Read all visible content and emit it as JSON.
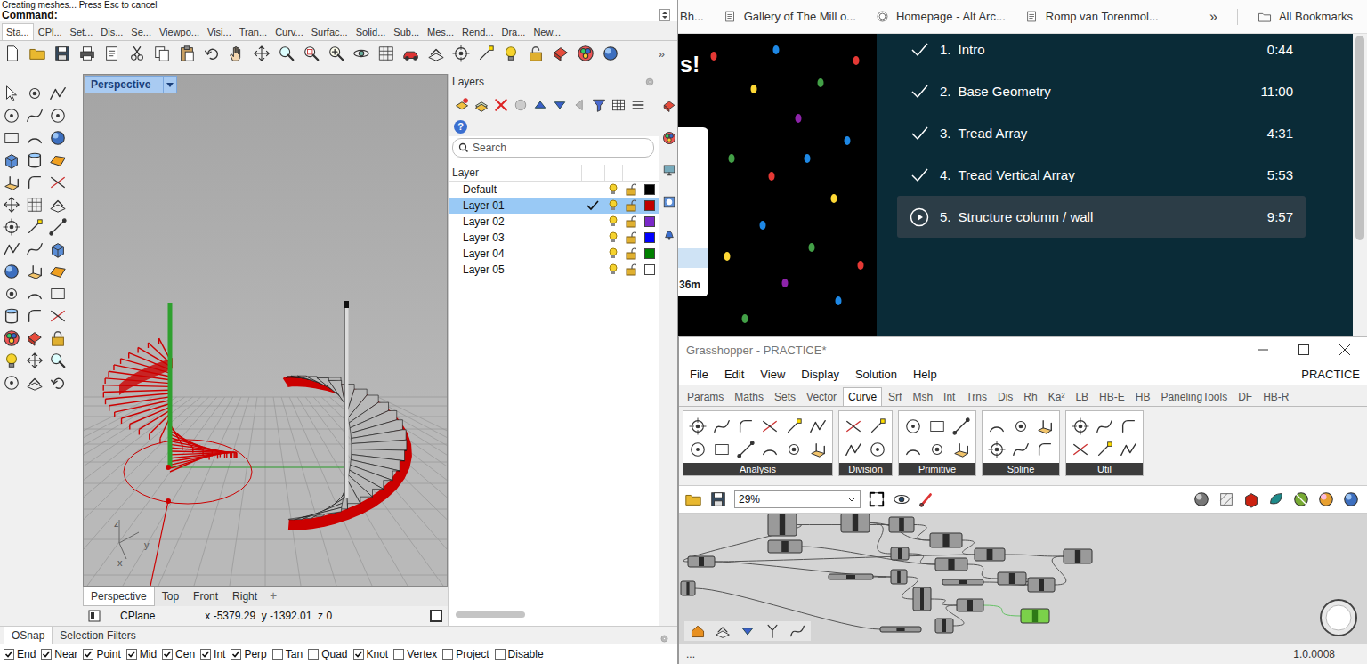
{
  "rhino": {
    "command_history": "Creating meshes... Press Esc to cancel",
    "command_prompt": "Command:",
    "toolbar_tabs": [
      {
        "label": "Sta...",
        "selected": true
      },
      {
        "label": "CPl...",
        "selected": false
      },
      {
        "label": "Set...",
        "selected": false
      },
      {
        "label": "Dis...",
        "selected": false
      },
      {
        "label": "Se...",
        "selected": false
      },
      {
        "label": "Viewpo...",
        "selected": false
      },
      {
        "label": "Visi...",
        "selected": false
      },
      {
        "label": "Tran...",
        "selected": false
      },
      {
        "label": "Curv...",
        "selected": false
      },
      {
        "label": "Surfac...",
        "selected": false
      },
      {
        "label": "Solid...",
        "selected": false
      },
      {
        "label": "Sub...",
        "selected": false
      },
      {
        "label": "Mes...",
        "selected": false
      },
      {
        "label": "Rend...",
        "selected": false
      },
      {
        "label": "Dra...",
        "selected": false
      },
      {
        "label": "New...",
        "selected": false
      }
    ],
    "toolbar_overflow": "»",
    "viewport": {
      "title": "Perspective",
      "axes": [
        "z",
        "y",
        "x"
      ]
    },
    "layers_panel": {
      "title": "Layers",
      "help": "?",
      "search_placeholder": "Search",
      "column": "Layer",
      "layers": [
        {
          "name": "Default",
          "selected": false,
          "current": false,
          "visible": true,
          "locked": false,
          "color": "#000000"
        },
        {
          "name": "Layer 01",
          "selected": true,
          "current": true,
          "visible": true,
          "locked": false,
          "color": "#c00000"
        },
        {
          "name": "Layer 02",
          "selected": false,
          "current": false,
          "visible": true,
          "locked": false,
          "color": "#7a28c8"
        },
        {
          "name": "Layer 03",
          "selected": false,
          "current": false,
          "visible": true,
          "locked": false,
          "color": "#0000ff"
        },
        {
          "name": "Layer 04",
          "selected": false,
          "current": false,
          "visible": true,
          "locked": false,
          "color": "#008000"
        },
        {
          "name": "Layer 05",
          "selected": false,
          "current": false,
          "visible": true,
          "locked": false,
          "color": "#ffffff"
        }
      ]
    },
    "viewport_tabs": [
      {
        "label": "Perspective",
        "selected": true
      },
      {
        "label": "Top",
        "selected": false
      },
      {
        "label": "Front",
        "selected": false
      },
      {
        "label": "Right",
        "selected": false
      }
    ],
    "add_viewport": "+",
    "status": {
      "cplane": "CPlane",
      "coordinates": "x -5379.29  y -1392.01  z 0"
    },
    "panel_tabs": [
      {
        "label": "OSnap",
        "selected": true
      },
      {
        "label": "Selection Filters",
        "selected": false
      }
    ],
    "osnaps": [
      {
        "label": "End",
        "checked": true
      },
      {
        "label": "Near",
        "checked": true
      },
      {
        "label": "Point",
        "checked": true
      },
      {
        "label": "Mid",
        "checked": true
      },
      {
        "label": "Cen",
        "checked": true
      },
      {
        "label": "Int",
        "checked": true
      },
      {
        "label": "Perp",
        "checked": true
      },
      {
        "label": "Tan",
        "checked": false
      },
      {
        "label": "Quad",
        "checked": false
      },
      {
        "label": "Knot",
        "checked": true
      },
      {
        "label": "Vertex",
        "checked": false
      },
      {
        "label": "Project",
        "checked": false
      },
      {
        "label": "Disable",
        "checked": false
      }
    ]
  },
  "browser": {
    "bookmarks": [
      "Bh...",
      "Gallery of The Mill o...",
      "Homepage - Alt Arc...",
      "Romp van Torenmol..."
    ],
    "overflow": "»",
    "all_bookmarks": "All Bookmarks",
    "page": {
      "headline": "s!",
      "card_meta": "36m"
    },
    "lessons": [
      {
        "number": "1.",
        "title": "Intro",
        "duration": "0:44",
        "completed": true,
        "selected": false
      },
      {
        "number": "2.",
        "title": "Base Geometry",
        "duration": "11:00",
        "completed": true,
        "selected": false
      },
      {
        "number": "3.",
        "title": "Tread Array",
        "duration": "4:31",
        "completed": true,
        "selected": false
      },
      {
        "number": "4.",
        "title": "Tread Vertical Array",
        "duration": "5:53",
        "completed": true,
        "selected": false
      },
      {
        "number": "5.",
        "title": "Structure column / wall",
        "duration": "9:57",
        "completed": false,
        "selected": true
      }
    ]
  },
  "grasshopper": {
    "title": "Grasshopper - PRACTICE*",
    "menus": [
      "File",
      "Edit",
      "View",
      "Display",
      "Solution",
      "Help"
    ],
    "document": "PRACTICE",
    "tabs": [
      {
        "label": "Params",
        "selected": false
      },
      {
        "label": "Maths",
        "selected": false
      },
      {
        "label": "Sets",
        "selected": false
      },
      {
        "label": "Vector",
        "selected": false
      },
      {
        "label": "Curve",
        "selected": true
      },
      {
        "label": "Srf",
        "selected": false
      },
      {
        "label": "Msh",
        "selected": false
      },
      {
        "label": "Int",
        "selected": false
      },
      {
        "label": "Trns",
        "selected": false
      },
      {
        "label": "Dis",
        "selected": false
      },
      {
        "label": "Rh",
        "selected": false
      },
      {
        "label": "Ka²",
        "selected": false
      },
      {
        "label": "LB",
        "selected": false
      },
      {
        "label": "HB-E",
        "selected": false
      },
      {
        "label": "HB",
        "selected": false
      },
      {
        "label": "PanelingTools",
        "selected": false
      },
      {
        "label": "DF",
        "selected": false
      },
      {
        "label": "HB-R",
        "selected": false
      }
    ],
    "ribbon_groups": [
      "Analysis",
      "Division",
      "Primitive",
      "Spline",
      "Util"
    ],
    "zoom": "29%",
    "status": "...",
    "version": "1.0.0008"
  }
}
